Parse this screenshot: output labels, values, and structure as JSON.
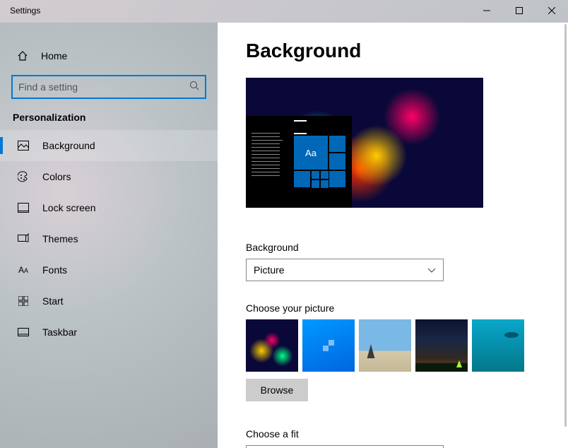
{
  "window": {
    "title": "Settings"
  },
  "sidebar": {
    "home_label": "Home",
    "search_placeholder": "Find a setting",
    "section_title": "Personalization",
    "items": [
      {
        "label": "Background",
        "icon": "image-icon",
        "selected": true
      },
      {
        "label": "Colors",
        "icon": "palette-icon",
        "selected": false
      },
      {
        "label": "Lock screen",
        "icon": "lockscreen-icon",
        "selected": false
      },
      {
        "label": "Themes",
        "icon": "themes-icon",
        "selected": false
      },
      {
        "label": "Fonts",
        "icon": "fonts-icon",
        "selected": false
      },
      {
        "label": "Start",
        "icon": "start-icon",
        "selected": false
      },
      {
        "label": "Taskbar",
        "icon": "taskbar-icon",
        "selected": false
      }
    ]
  },
  "main": {
    "title": "Background",
    "preview_tile_label": "Aa",
    "background_label": "Background",
    "background_select_value": "Picture",
    "choose_picture_label": "Choose your picture",
    "browse_label": "Browse",
    "choose_fit_label": "Choose a fit"
  }
}
